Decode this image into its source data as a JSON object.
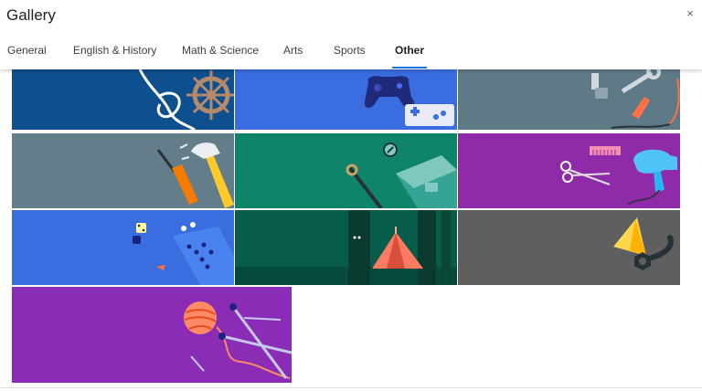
{
  "dialog": {
    "title": "Gallery",
    "close_label": "×"
  },
  "tabs": [
    {
      "label": "General",
      "active": false
    },
    {
      "label": "English & History",
      "active": false
    },
    {
      "label": "Math & Science",
      "active": false
    },
    {
      "label": "Arts",
      "active": false
    },
    {
      "label": "Sports",
      "active": false
    },
    {
      "label": "Other",
      "active": true
    }
  ],
  "colors": {
    "active_tab_underline": "#1a73e8",
    "tile_nautical": "#0d4f8f",
    "tile_gaming": "#3a6de0",
    "tile_tools": "#5f7a87",
    "tile_hammer": "#637d8b",
    "tile_teal": "#0e8468",
    "tile_salon": "#8f2aa8",
    "tile_boardgame": "#3a6de0",
    "tile_camping": "#075c4a",
    "tile_gray": "#5f5f5f",
    "tile_knitting": "#8a2cb5"
  },
  "tiles": [
    {
      "theme": "nautical",
      "icons": [
        "rope-knot-icon",
        "ship-wheel-icon"
      ]
    },
    {
      "theme": "video-games",
      "icons": [
        "game-controller-icon",
        "retro-gamepad-icon"
      ]
    },
    {
      "theme": "mechanic",
      "icons": [
        "spark-plug-icon",
        "wrench-icon",
        "jumper-cable-icon"
      ]
    },
    {
      "theme": "carpentry",
      "icons": [
        "screwdriver-icon",
        "hammer-icon"
      ]
    },
    {
      "theme": "aquarium",
      "icons": [
        "compass-icon",
        "tank-icon"
      ]
    },
    {
      "theme": "salon",
      "icons": [
        "scissors-icon",
        "comb-icon",
        "hair-dryer-icon"
      ]
    },
    {
      "theme": "board-games",
      "icons": [
        "dice-icon",
        "game-board-icon"
      ]
    },
    {
      "theme": "camping",
      "icons": [
        "tent-icon",
        "tree-icon"
      ]
    },
    {
      "theme": "traffic",
      "icons": [
        "traffic-cone-icon"
      ]
    },
    {
      "theme": "knitting",
      "icons": [
        "yarn-ball-icon",
        "knitting-needle-icon"
      ]
    }
  ]
}
